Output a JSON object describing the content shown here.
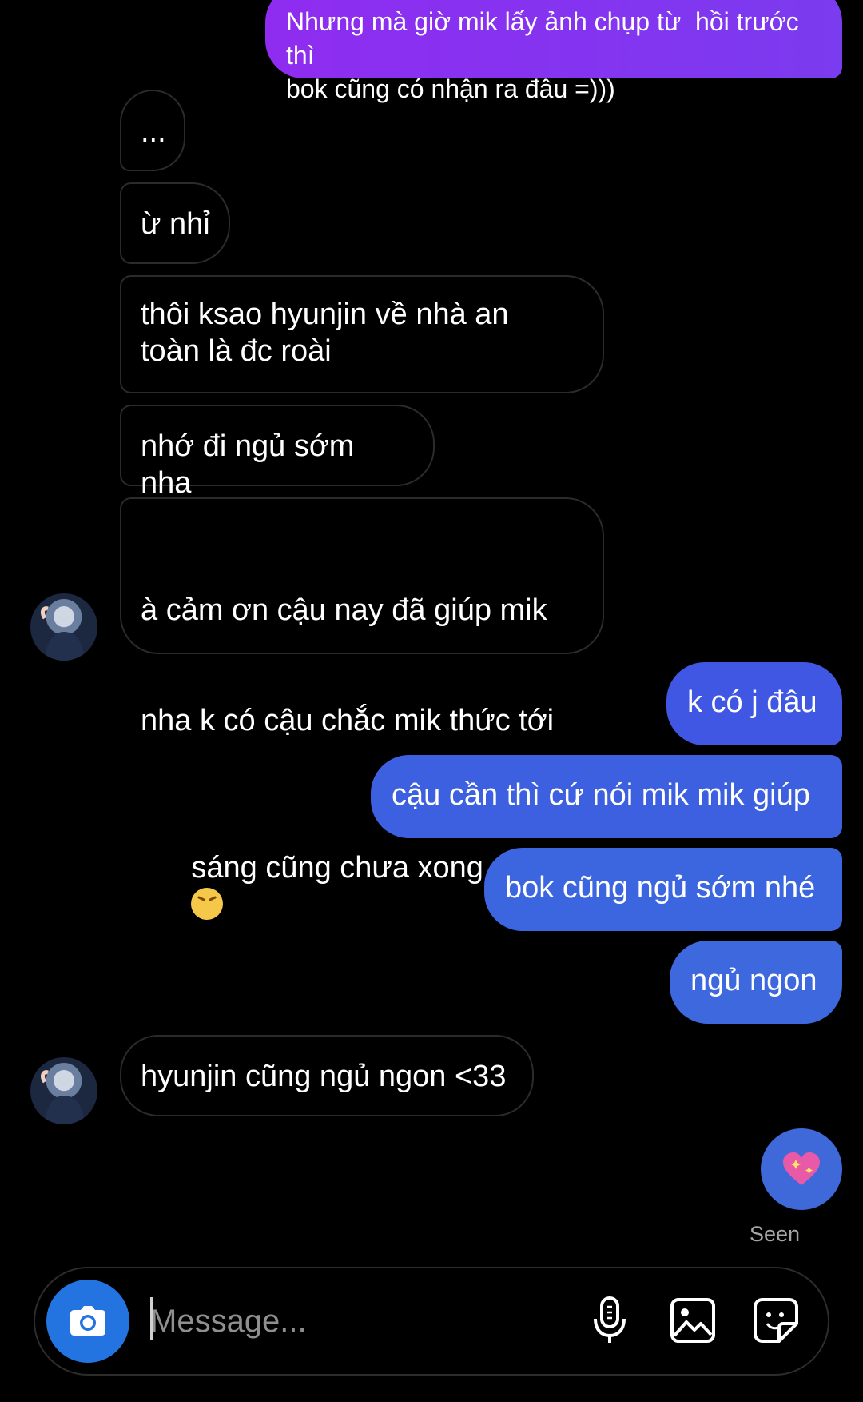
{
  "colors": {
    "background": "#000000",
    "received_border": "#2b2b2b",
    "sent_gradient_top": "#8b2cf0",
    "sent_gradient_mid": "#5b3fe6",
    "sent_gradient_bottom": "#3f68d9",
    "seen_text": "#a6a6a6",
    "camera_button": "#2374e1"
  },
  "messages": [
    {
      "id": 1,
      "sender": "me",
      "text": "Nhưng mà giờ mik lấy ảnh chụp từ  hồi trước thì\nbok cũng có nhận ra đâu =)))"
    },
    {
      "id": 2,
      "sender": "them",
      "text": "..."
    },
    {
      "id": 3,
      "sender": "them",
      "text": "ừ nhỉ"
    },
    {
      "id": 4,
      "sender": "them",
      "text": "thôi ksao hyunjin về nhà an\ntoàn là đc roài"
    },
    {
      "id": 5,
      "sender": "them",
      "text": "nhớ đi ngủ sớm nha"
    },
    {
      "id": 6,
      "sender": "them",
      "line1": "à cảm ơn cậu nay đã giúp mik",
      "line2": "nha k có cậu chắc mik thức tới",
      "line3": "sáng cũng chưa xong",
      "emoji": "confounded-face-emoji"
    },
    {
      "id": 7,
      "sender": "me",
      "text": "k có j đâu"
    },
    {
      "id": 8,
      "sender": "me",
      "text": "cậu cần thì cứ nói mik mik giúp"
    },
    {
      "id": 9,
      "sender": "me",
      "text": "bok cũng ngủ sớm nhé"
    },
    {
      "id": 10,
      "sender": "me",
      "text": "ngủ ngon"
    },
    {
      "id": 11,
      "sender": "them",
      "text": "hyunjin cũng ngủ ngon <33"
    },
    {
      "id": 12,
      "sender": "me",
      "emoji": "sparkling-heart-emoji"
    }
  ],
  "status": {
    "seen": "Seen"
  },
  "composer": {
    "placeholder": "Message...",
    "icons": [
      "camera-icon",
      "microphone-icon",
      "gallery-icon",
      "sticker-icon"
    ]
  }
}
